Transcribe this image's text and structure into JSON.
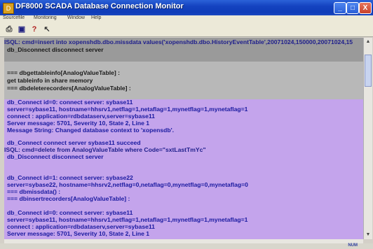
{
  "window": {
    "title": "DF8000 SCADA Database Connection Monitor",
    "minimize_glyph": "_",
    "maximize_glyph": "□",
    "close_glyph": "X",
    "app_icon": "app-icon"
  },
  "menu": {
    "items": [
      "Sourcefile",
      "Monitoring",
      "Window",
      "Help"
    ]
  },
  "toolbar": {
    "icons": [
      "print-icon",
      "save-icon",
      "help-icon",
      "pointer-icon"
    ],
    "glyphs": [
      "⎙",
      "▣",
      "?",
      "↖"
    ]
  },
  "log": {
    "lines": [
      "ISQL: cmd=insert into xopenshdb.dbo.missdata values('xopenshdb.dbo.HistoryEventTable',20071024,150000,20071024,15",
      "  db_Disconnect disconnect server",
      "  === dbgettableinfo[AnalogValueTable] :",
      "    get tableinfo in share memory",
      "  === dbdeleterecorders[AnalogValueTable] :",
      "  db_Connect id=0: connect server: sybase11",
      "     server=sybase11, hostname=hhsrv1,netflag=1,netaflag=1,mynetflag=1,mynetaflag=1",
      "     connect : application=rdbdataserv,server=sybase11",
      "   Server message: 5701, Severity 10, State 2, Line 1",
      "   Message String: Changed database context to 'xopensdb'.",
      "     db_Connect connect server sybase11 succeed",
      "ISQL: cmd=delete from AnalogValueTable where Code=\"sxtLastTmYc\"",
      "  db_Disconnect disconnect server",
      "  db_Connect id=1: connect server: sybase22",
      "     server=sybase22, hostname=hhsrv2,netflag=0,netaflag=0,mynetflag=0,mynetaflag=0",
      "  === dbmissdata() :",
      "  === dbinsertrecorders[AnalogValueTable] :",
      "  db_Connect id=0: connect server: sybase11",
      "     server=sybase11, hostname=hhsrv1,netflag=1,netaflag=1,mynetflag=1,mynetaflag=1",
      "     connect : application=rdbdataserv,server=sybase11",
      "   Server message: 5701, Severity 10, State 2, Line 1"
    ]
  },
  "status": {
    "num": "NUM"
  },
  "colors": {
    "titlebar": "#0f3cb8",
    "log_background": "#c4a4ec",
    "gray_band": "#9a9a9a"
  }
}
